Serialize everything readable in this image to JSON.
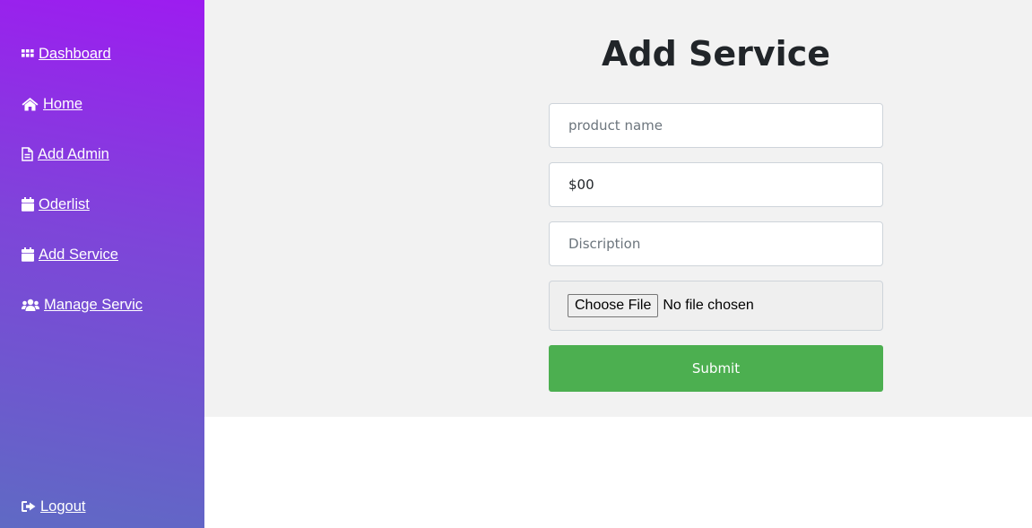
{
  "sidebar": {
    "background": [
      "#9d1cf0",
      "#5f6ac4"
    ],
    "items": [
      {
        "label": " Dashboard",
        "icon": "grid-icon"
      },
      {
        "label": " Home",
        "icon": "home-icon"
      },
      {
        "label": " Add Admin",
        "icon": "document-icon"
      },
      {
        "label": " Oderlist",
        "icon": "calendar-icon"
      },
      {
        "label": " Add Service",
        "icon": "calendar-icon"
      },
      {
        "label": " Manage Servic",
        "icon": "users-icon"
      }
    ],
    "logout": {
      "label": " Logout",
      "icon": "sign-out-icon"
    }
  },
  "main": {
    "title": "Add Service",
    "form": {
      "product_name_placeholder": "product name",
      "price_value": "$00",
      "description_placeholder": "Discription",
      "file_button_label": "Choose File",
      "file_status": "No file chosen",
      "submit_label": "Submit",
      "submit_color": "#4caf50"
    }
  }
}
